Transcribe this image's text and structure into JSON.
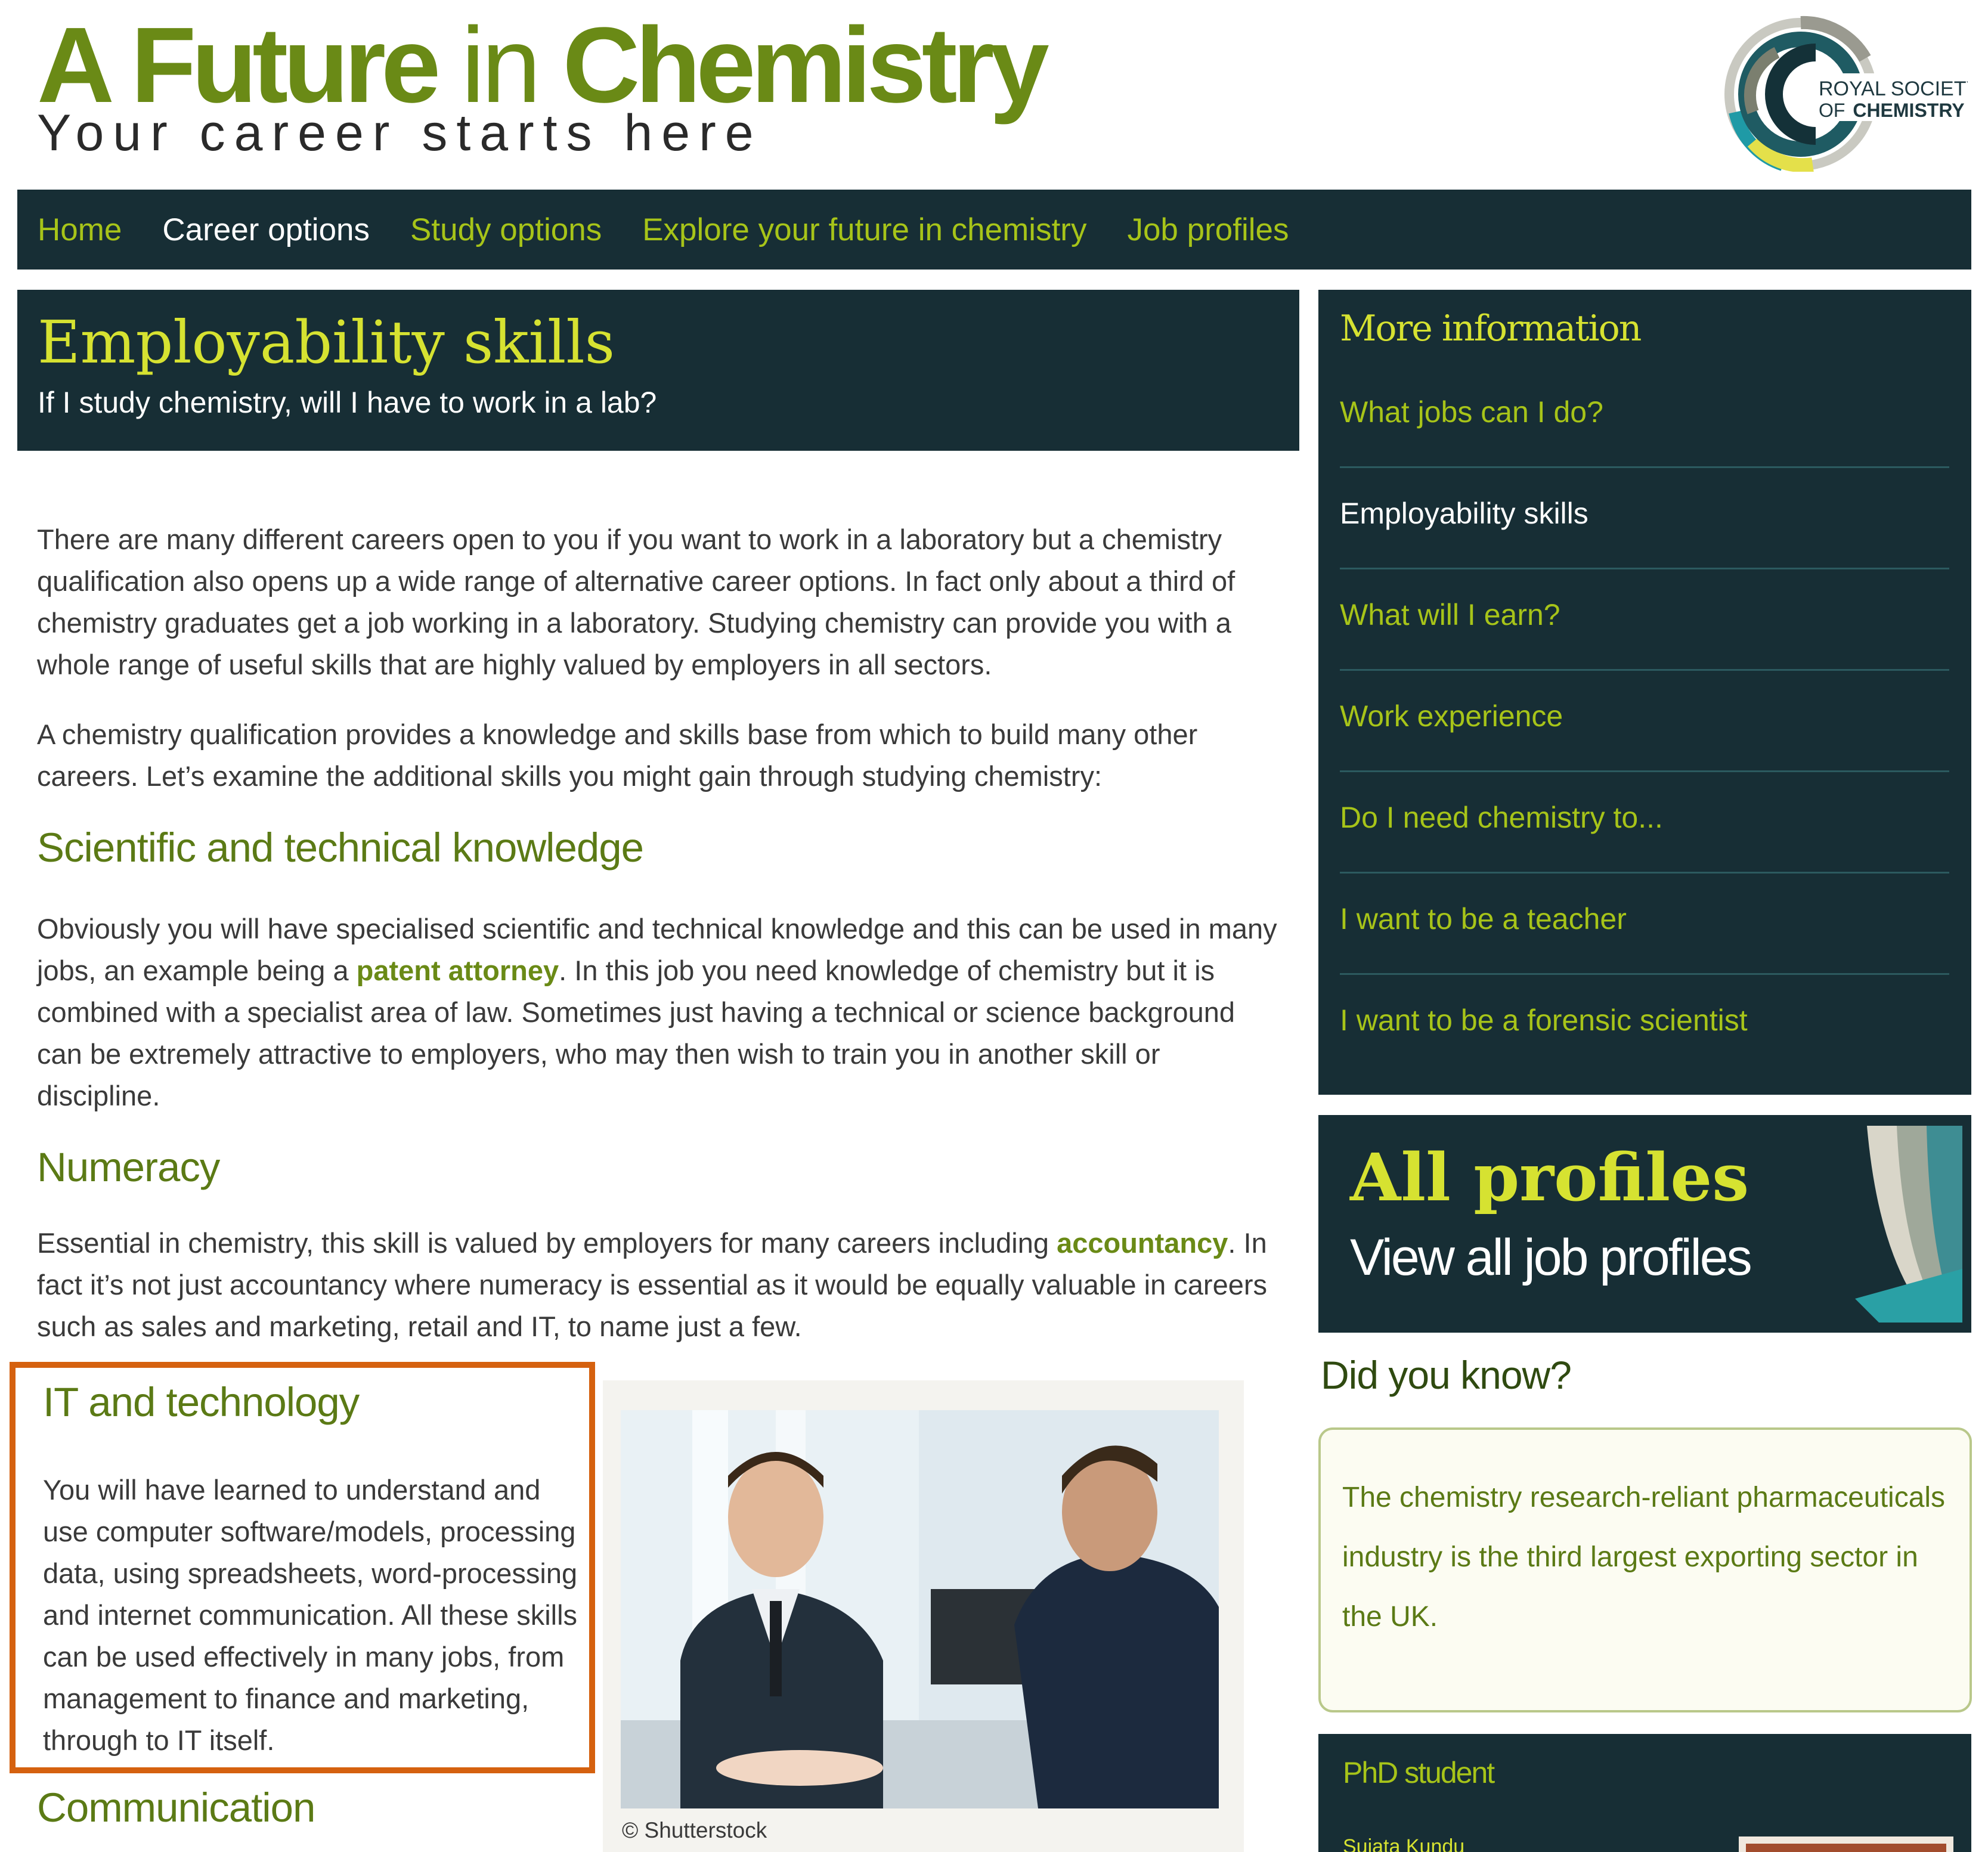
{
  "header": {
    "title_part1": "A Future",
    "title_part2": "in",
    "title_part3": "Chemistry",
    "tagline": "Your career starts here",
    "logo_line1": "ROYAL SOCIETY",
    "logo_line2_prefix": "OF",
    "logo_line2_main": "CHEMISTRY"
  },
  "nav": {
    "items": [
      "Home",
      "Career options",
      "Study options",
      "Explore your future in chemistry",
      "Job profiles"
    ],
    "active": "Career options"
  },
  "page": {
    "title": "Employability skills",
    "subtitle": "If I study chemistry, will I have to work in a lab?"
  },
  "content": {
    "intro1": "There are many different careers open to you if you want to work in a laboratory but a chemistry qualification also opens up a wide range of alternative career options. In fact only about a third of chemistry graduates get a job working in a laboratory. Studying chemistry can provide you with a whole range of useful skills that are highly valued by employers in all sectors.",
    "intro2": "A chemistry qualification provides a knowledge and skills base from which to build many other careers. Let’s examine the additional skills you might gain through studying chemistry:",
    "sections": {
      "scientific": {
        "heading": "Scientific and technical knowledge",
        "text_before": "Obviously you will have specialised scientific and technical knowledge and this can be used in many jobs, an example being a ",
        "link": "patent attorney",
        "text_after": ". In this job you need knowledge of chemistry but it is combined with a specialist area of law. Sometimes just having a technical or science background can be extremely attractive to employers, who may then wish to train you in another skill or discipline."
      },
      "numeracy": {
        "heading": "Numeracy",
        "text_before": "Essential in chemistry, this skill is valued by employers for many careers including ",
        "link": "accountancy",
        "text_after": ". In fact it’s not just accountancy where numeracy is essential as it would be equally valuable in careers such as sales and marketing, retail and IT, to name just a few."
      },
      "it": {
        "heading": "IT and technology",
        "text": "You will have learned to understand and use computer software/models, processing data, using spreadsheets, word-processing and internet communication. All these skills can be used effectively in many jobs, from management to finance and marketing, through to IT itself."
      },
      "communication": {
        "heading": "Communication"
      }
    },
    "photo_credit": "© Shutterstock"
  },
  "sidebar": {
    "more_title": "More information",
    "links": [
      {
        "label": "What jobs can I do?",
        "active": false
      },
      {
        "label": "Employability skills",
        "active": true
      },
      {
        "label": "What will I earn?",
        "active": false
      },
      {
        "label": "Work experience",
        "active": false
      },
      {
        "label": "Do I need chemistry to...",
        "active": false
      },
      {
        "label": "I want to be a teacher",
        "active": false
      },
      {
        "label": "I want to be a forensic scientist",
        "active": false
      }
    ],
    "all_profiles_title": "All profiles",
    "all_profiles_sub": "View all job profiles",
    "did_you_know_title": "Did you know?",
    "did_you_know_text": "The chemistry research-reliant pharmaceuticals industry is the third largest exporting sector in the UK.",
    "phd_title": "PhD student",
    "phd_name": "Sujata Kundu"
  },
  "colors": {
    "brand_green": "#6a8a16",
    "nav_bg": "#172e35",
    "accent_lime": "#a7c419",
    "accent_yellow": "#d6e231",
    "highlight_orange": "#d5610f"
  }
}
